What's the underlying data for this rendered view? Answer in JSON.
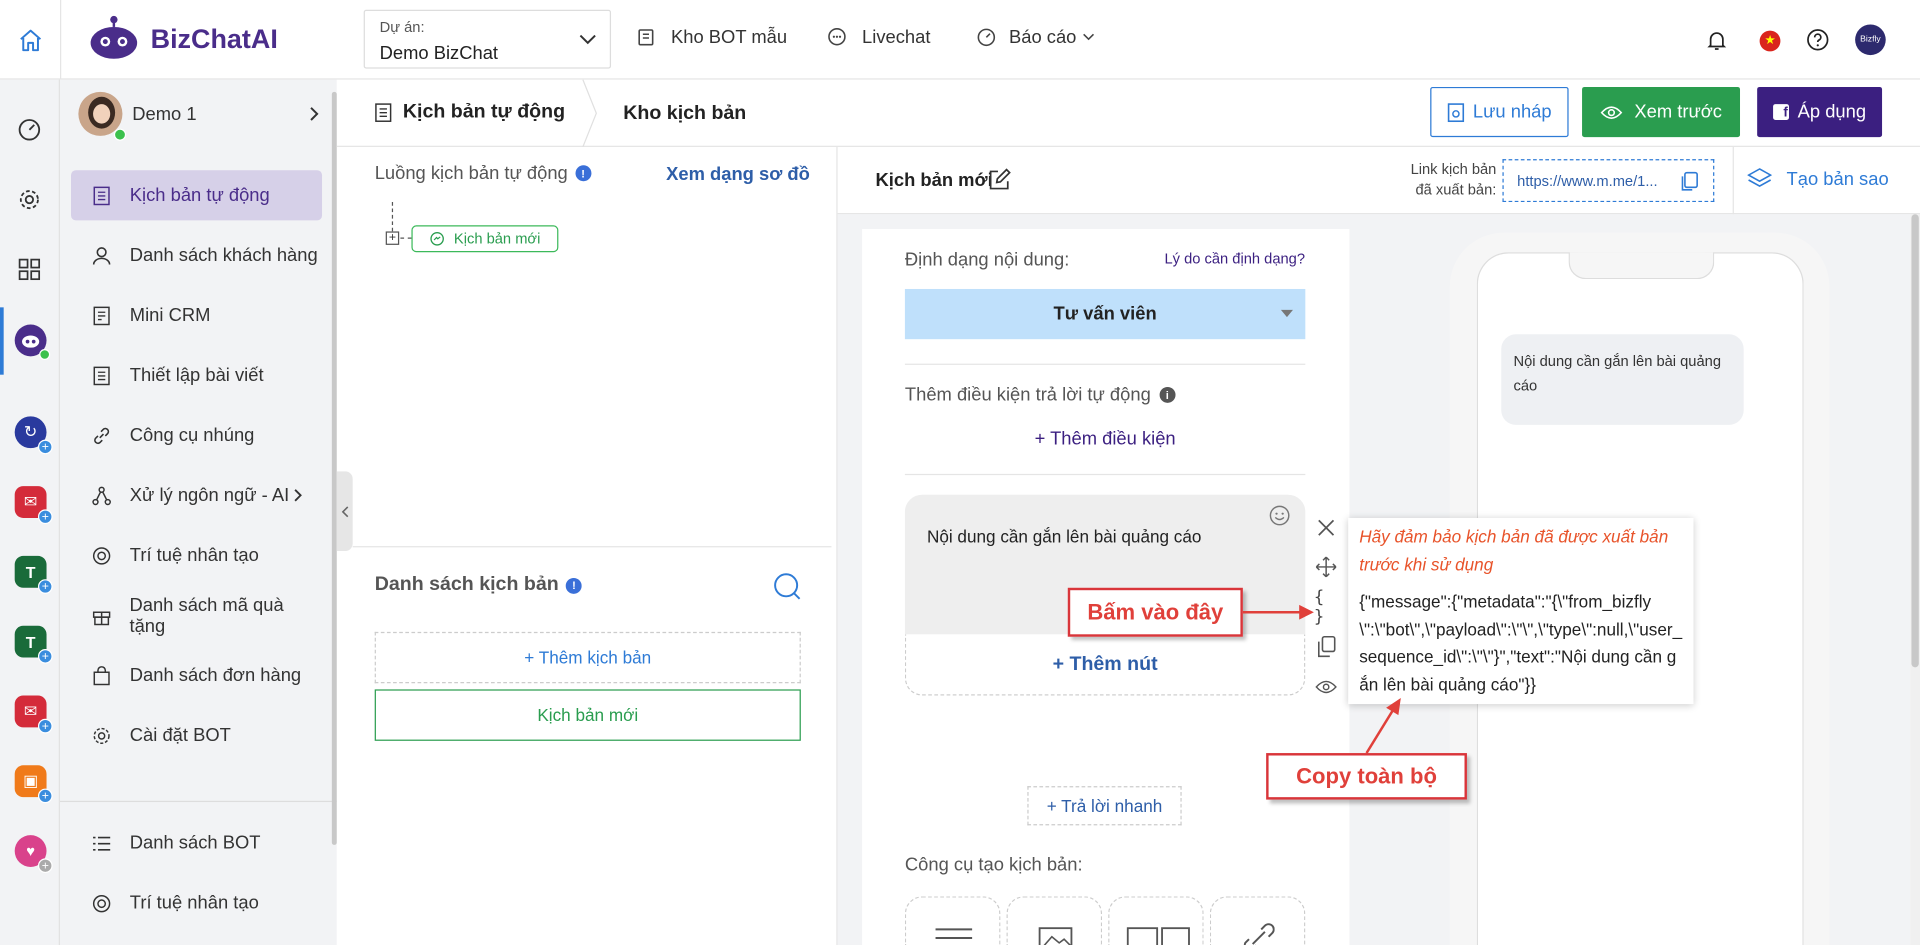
{
  "brand": {
    "name": "BizChatAI"
  },
  "header": {
    "project_label": "Dự án:",
    "project_value": "Demo BizChat",
    "nav": [
      {
        "label": "Kho BOT mẫu"
      },
      {
        "label": "Livechat"
      },
      {
        "label": "Báo cáo"
      }
    ]
  },
  "account": {
    "name": "Demo 1"
  },
  "sidebar": {
    "items": [
      {
        "label": "Kịch bản tự động"
      },
      {
        "label": "Danh sách khách hàng"
      },
      {
        "label": "Mini CRM"
      },
      {
        "label": "Thiết lập bài viết"
      },
      {
        "label": "Công cụ nhúng"
      },
      {
        "label": "Xử lý ngôn ngữ - AI"
      },
      {
        "label": "Trí tuệ nhân tạo"
      },
      {
        "label": "Danh sách mã quà tặng"
      },
      {
        "label": "Danh sách đơn hàng"
      },
      {
        "label": "Cài đặt BOT"
      }
    ],
    "bottom_items": [
      {
        "label": "Danh sách BOT"
      },
      {
        "label": "Trí tuệ nhân tạo"
      }
    ]
  },
  "subheader": {
    "crumb1": "Kịch bản tự động",
    "crumb2": "Kho kịch bản",
    "save_draft": "Lưu nháp",
    "preview": "Xem trước",
    "apply": "Áp dụng"
  },
  "flow": {
    "title": "Luồng kịch bản tự động",
    "view_diagram": "Xem dạng sơ đồ",
    "node_label": "Kịch bản mới"
  },
  "scenario_list": {
    "title": "Danh sách kịch bản",
    "add": "+ Thêm kịch bản",
    "items": [
      "Kịch bản mới"
    ]
  },
  "editor": {
    "title": "Kịch bản mới",
    "link_label_1": "Link kịch bản",
    "link_label_2": "đã xuất bản:",
    "link_value": "https://www.m.me/1...",
    "clone": "Tạo bản sao",
    "format_label": "Định dạng nội dung:",
    "format_why": "Lý do cần định dạng?",
    "format_value": "Tư vấn viên",
    "cond_label": "Thêm điều kiện trả lời tự động",
    "add_cond": "+ Thêm điều kiện",
    "message_text": "Nội dung cần gắn lên bài quảng cáo",
    "add_button": "+ Thêm nút",
    "quick_reply": "+ Trả lời nhanh",
    "tools_label": "Công cụ tạo kịch bản:"
  },
  "json_popup": {
    "warning": "Hãy đảm bảo kịch bản đã được xuất bản trước khi sử dụng",
    "code": "{\"message\":{\"metadata\":\"{\\\"from_bizfly\\\":\\\"bot\\\",\\\"payload\\\":\\\"\\\",\\\"type\\\":null,\\\"user_sequence_id\\\":\\\"\\\"}\",\"text\":\"Nội dung cần gắn lên bài quảng cáo\"}}"
  },
  "annotations": {
    "click_here": "Bấm vào đây",
    "copy_all": "Copy toàn bộ"
  },
  "phone": {
    "bubble": "Nội dung cần gắn lên bài quảng cáo"
  },
  "colors": {
    "brand": "#4a2d8a",
    "accent_blue": "#2e5ea8",
    "green": "#2a9d4f",
    "apply": "#3b1f80",
    "callout_red": "#e0403a",
    "format_bg": "#bfe0fb"
  }
}
